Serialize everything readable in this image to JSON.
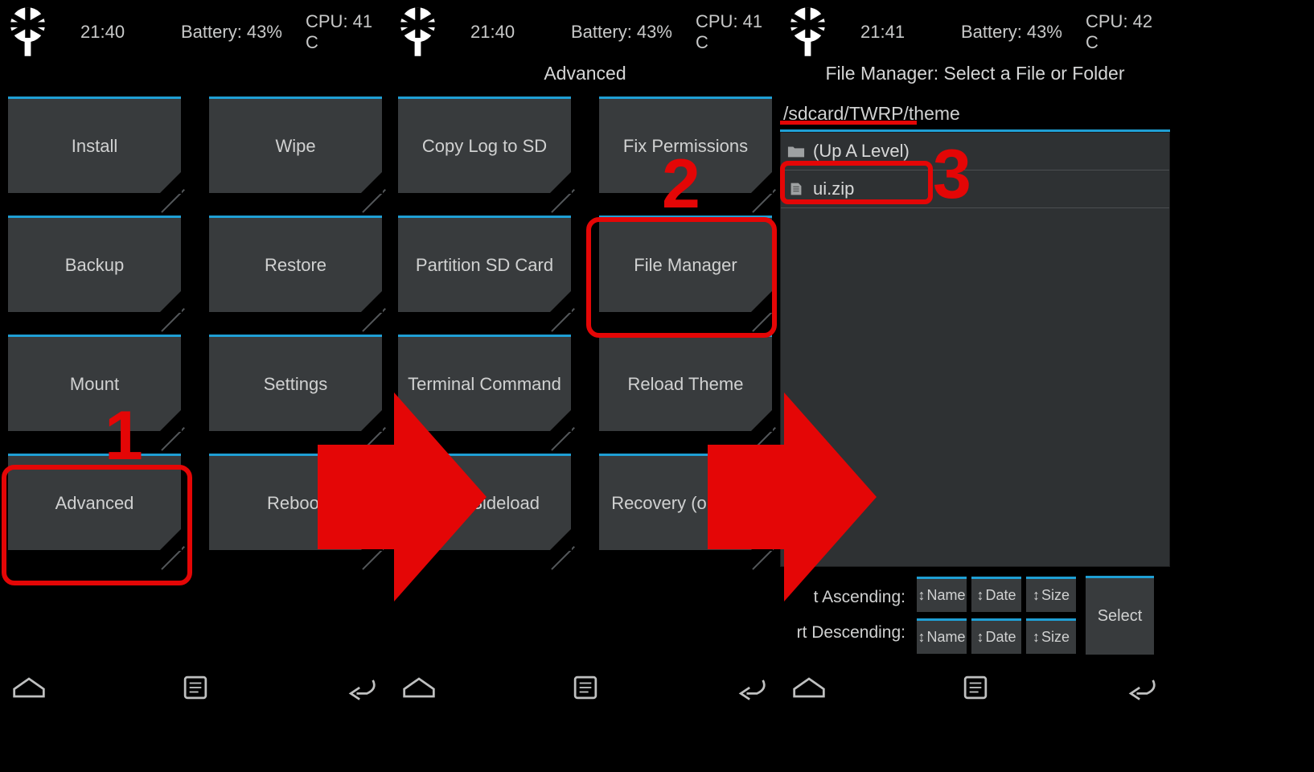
{
  "screen1": {
    "status": {
      "time": "21:40",
      "battery": "Battery: 43%",
      "cpu": "CPU: 41 C"
    },
    "subtitle": "",
    "buttons": [
      [
        "Install",
        "Wipe"
      ],
      [
        "Backup",
        "Restore"
      ],
      [
        "Mount",
        "Settings"
      ],
      [
        "Advanced",
        "Reboot"
      ]
    ]
  },
  "screen2": {
    "status": {
      "time": "21:40",
      "battery": "Battery: 43%",
      "cpu": "CPU: 41 C"
    },
    "subtitle": "Advanced",
    "buttons": [
      [
        "Copy Log to SD",
        "Fix Permissions"
      ],
      [
        "Partition SD Card",
        "File Manager"
      ],
      [
        "Terminal Command",
        "Reload Theme"
      ],
      [
        "ADB Sideload",
        "Recovery (only SO"
      ]
    ]
  },
  "screen3": {
    "status": {
      "time": "21:41",
      "battery": "Battery: 43%",
      "cpu": "CPU: 42 C"
    },
    "subtitle": "File Manager: Select a File or Folder",
    "path": "/sdcard/TWRP/theme",
    "rows": [
      {
        "icon": "folder",
        "label": "(Up A Level)"
      },
      {
        "icon": "file",
        "label": "ui.zip"
      }
    ],
    "sort": {
      "ascLabel": "t Ascending:",
      "descLabel": "rt Descending:",
      "cols": [
        "Name",
        "Date",
        "Size"
      ]
    },
    "select": "Select"
  },
  "annotations": {
    "num1": "1",
    "num2": "2",
    "num3": "3"
  }
}
